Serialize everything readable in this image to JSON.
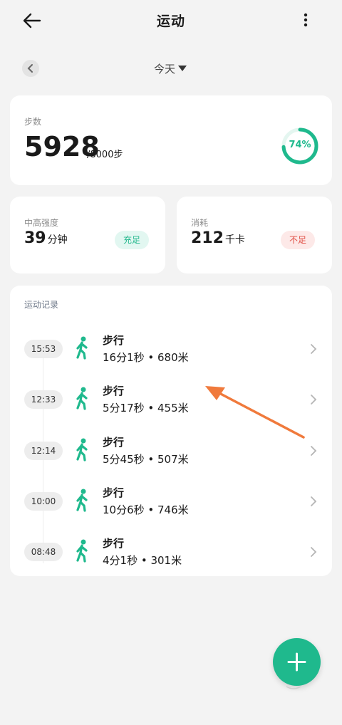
{
  "header": {
    "title": "运动"
  },
  "date_selector": {
    "label": "今天"
  },
  "steps": {
    "label": "步数",
    "value": "5928",
    "goal": "/8000步",
    "progress_text": "74%",
    "progress": 0.74
  },
  "intensity": {
    "label": "中高强度",
    "value": "39",
    "unit": "分钟",
    "badge": "充足"
  },
  "burn": {
    "label": "消耗",
    "value": "212",
    "unit": "千卡",
    "badge": "不足"
  },
  "records": {
    "label": "运动记录",
    "items": [
      {
        "time": "15:53",
        "type": "步行",
        "detail": "16分1秒 • 680米"
      },
      {
        "time": "12:33",
        "type": "步行",
        "detail": "5分17秒 • 455米"
      },
      {
        "time": "12:14",
        "type": "步行",
        "detail": "5分45秒 • 507米"
      },
      {
        "time": "10:00",
        "type": "步行",
        "detail": "10分6秒 • 746米"
      },
      {
        "time": "08:48",
        "type": "步行",
        "detail": "4分1秒 • 301米"
      }
    ]
  },
  "colors": {
    "accent": "#1fb98d",
    "warning": "#e04f45",
    "annotation_arrow": "#f07a3c"
  },
  "icons": {
    "back": "back-arrow-icon",
    "more": "more-vertical-icon",
    "walk": "walking-person-icon",
    "add": "plus-icon"
  }
}
